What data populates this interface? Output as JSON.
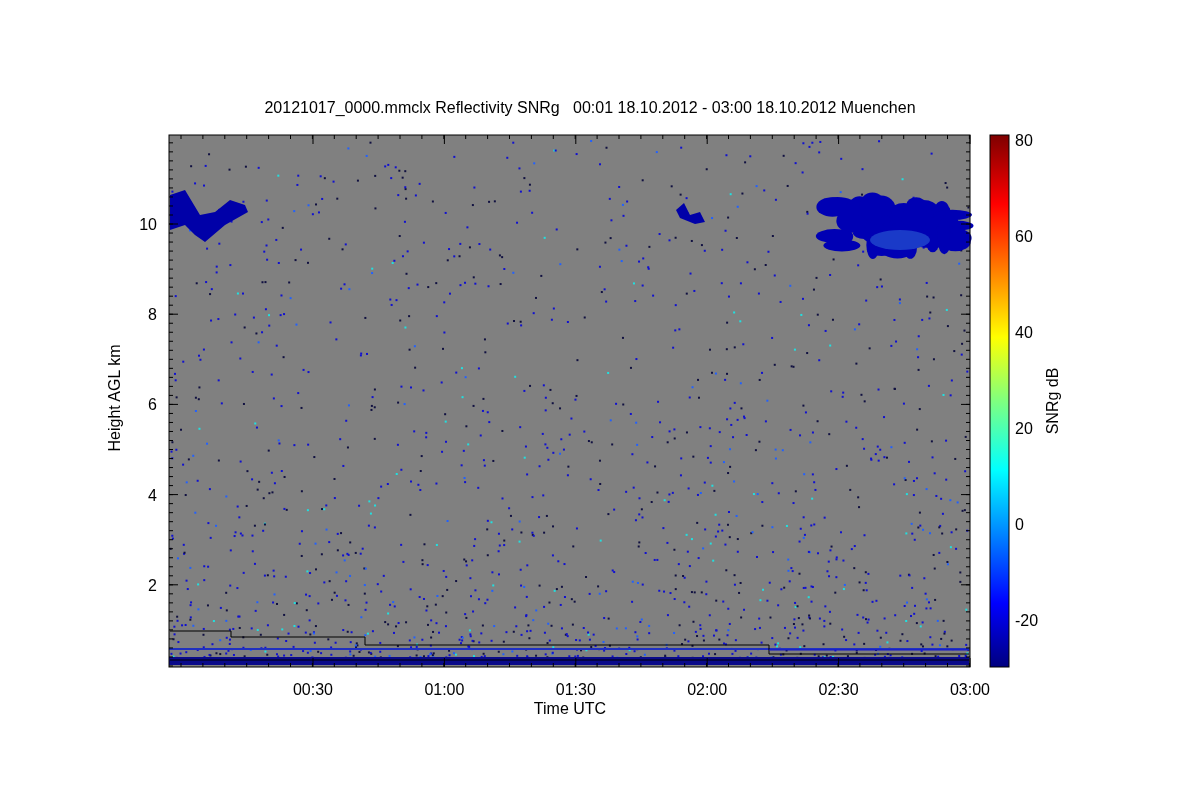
{
  "title": "20121017_0000.mmclx Reflectivity SNRg   00:01 18.10.2012 - 03:00 18.10.2012 Muenchen",
  "xlabel": "Time UTC",
  "ylabel": "Height AGL km",
  "xticks": [
    "00:30",
    "01:00",
    "01:30",
    "02:00",
    "02:30",
    "03:00"
  ],
  "yticks": [
    "10",
    "8",
    "6",
    "4",
    "2"
  ],
  "colorbar": {
    "label": "SNRg dB",
    "ticks": [
      "80",
      "60",
      "40",
      "20",
      "0",
      "-20"
    ]
  }
}
